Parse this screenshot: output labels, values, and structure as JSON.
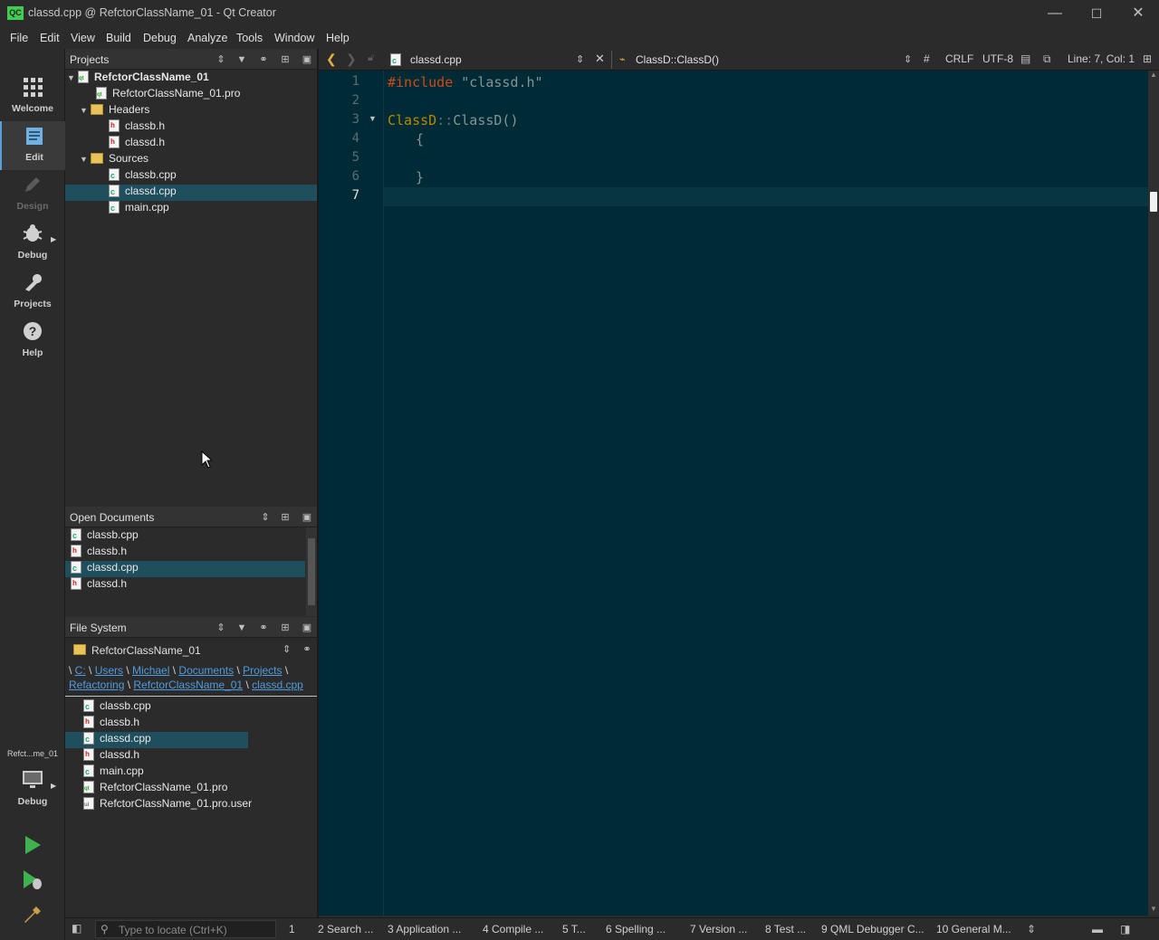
{
  "window": {
    "title": "classd.cpp @ RefctorClassName_01 - Qt Creator",
    "logo": "QC",
    "minimize": "—",
    "maximize": "☐",
    "close": "✕"
  },
  "menu": [
    "File",
    "Edit",
    "View",
    "Build",
    "Debug",
    "Analyze",
    "Tools",
    "Window",
    "Help"
  ],
  "modes": {
    "welcome": "Welcome",
    "edit": "Edit",
    "design": "Design",
    "debug": "Debug",
    "projects": "Projects",
    "help": "Help",
    "kit_name": "Refct...me_01",
    "kit_mode": "Debug"
  },
  "projects_panel": {
    "title": "Projects",
    "root": "RefctorClassName_01",
    "pro_file": "RefctorClassName_01.pro",
    "headers_label": "Headers",
    "headers": [
      "classb.h",
      "classd.h"
    ],
    "sources_label": "Sources",
    "sources": [
      "classb.cpp",
      "classd.cpp",
      "main.cpp"
    ]
  },
  "open_documents": {
    "title": "Open Documents",
    "files": [
      "classb.cpp",
      "classb.h",
      "classd.cpp",
      "classd.h"
    ]
  },
  "file_system": {
    "title": "File System",
    "location": "RefctorClassName_01",
    "path_line1": [
      "C:",
      "Users",
      "Michael",
      "Documents",
      "Projects"
    ],
    "path_line2": [
      "Refactoring",
      "RefctorClassName_01",
      "classd.cpp"
    ],
    "files": [
      "classb.cpp",
      "classb.h",
      "classd.cpp",
      "classd.h",
      "main.cpp",
      "RefctorClassName_01.pro",
      "RefctorClassName_01.pro.user"
    ]
  },
  "editor": {
    "file": "classd.cpp",
    "symbol": "ClassD::ClassD()",
    "hash": "#",
    "line_ending": "CRLF",
    "encoding": "UTF-8",
    "cursor": "Line: 7, Col: 1",
    "line_numbers": [
      "1",
      "2",
      "3",
      "4",
      "5",
      "6",
      "7"
    ],
    "code": {
      "l1_kw": "#include",
      "l1_str": "\"classd.h\"",
      "l3_class": "ClassD",
      "l3_sep": "::",
      "l3_fn": "ClassD()",
      "l4": "{",
      "l6": "}"
    }
  },
  "statusbar": {
    "locate_placeholder": "Type to locate (Ctrl+K)",
    "tabs": [
      "1",
      "2  Search ...",
      "3  Application ...",
      "4  Compile ...",
      "5  T...",
      "6  Spelling ...",
      "7  Version ...",
      "8  Test ...",
      "9  QML Debugger C...",
      "10  General M..."
    ]
  },
  "colors": {
    "editor_bg": "#002b36",
    "selection": "#1f4e5c",
    "keyword": "#cb4b16",
    "string": "#839496",
    "class": "#b58900"
  }
}
